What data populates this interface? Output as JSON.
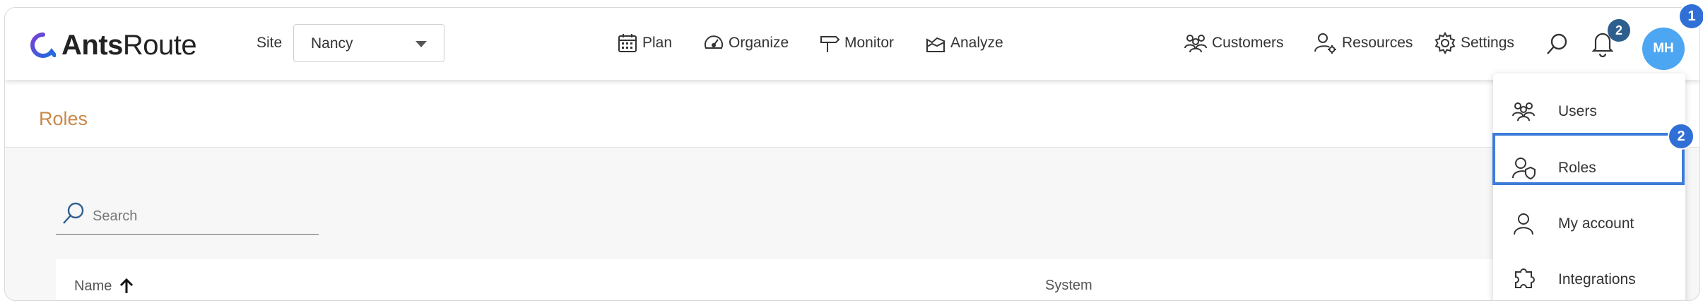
{
  "app": {
    "logo_bold": "Ants",
    "logo_rest": "Route"
  },
  "site": {
    "label": "Site",
    "value": "Nancy"
  },
  "nav": {
    "plan": "Plan",
    "organize": "Organize",
    "monitor": "Monitor",
    "analyze": "Analyze",
    "customers": "Customers",
    "resources": "Resources",
    "settings": "Settings"
  },
  "notifications": {
    "count": "2"
  },
  "user": {
    "initials": "MH"
  },
  "page": {
    "title": "Roles"
  },
  "search": {
    "placeholder": "Search",
    "value": ""
  },
  "table": {
    "columns": [
      "Name",
      "System"
    ],
    "sort": "ascending"
  },
  "user_menu": {
    "items": [
      {
        "label": "Users",
        "icon": "users-icon"
      },
      {
        "label": "Roles",
        "icon": "roles-icon"
      },
      {
        "label": "My account",
        "icon": "account-icon"
      },
      {
        "label": "Integrations",
        "icon": "integrations-icon"
      }
    ]
  },
  "annotations": {
    "step1": "1",
    "step2": "2"
  },
  "colors": {
    "accent": "#3d7bd9",
    "avatar": "#4da6f2",
    "title": "#c8884a",
    "badge": "#2d5e8e"
  }
}
